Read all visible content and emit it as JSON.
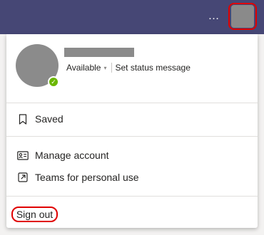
{
  "topbar": {
    "more_icon": "…",
    "accent_color": "#464775"
  },
  "profile": {
    "status": "Available",
    "status_color": "#6bb700",
    "status_message_link": "Set status message"
  },
  "menu": {
    "saved": "Saved",
    "manage_account": "Manage account",
    "teams_personal": "Teams for personal use",
    "sign_out": "Sign out"
  }
}
